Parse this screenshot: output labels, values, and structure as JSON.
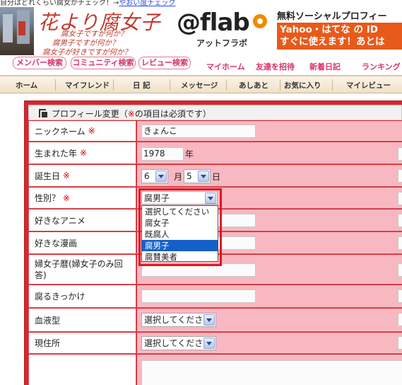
{
  "top_strip": {
    "text": "自分はどれくらい腐女かチェック！→",
    "link": "やおい度チェック"
  },
  "header": {
    "title": "花より腐女子",
    "taglines": [
      "腐女子ですが何か？",
      "腐男子ですが何か？",
      "腐女子が好きですが何か？"
    ],
    "flab_logo": "@flab",
    "flab_kana": "アットフラボ",
    "banner_title": "無料ソーシャルプロフィー",
    "banner_line1": "Yahoo・はてな の ID",
    "banner_line2": "すぐに使えます！あとは"
  },
  "search_tabs": [
    "メンバー検索",
    "コミュニティ検索",
    "レビュー検索"
  ],
  "top_nav": [
    "マイホーム",
    "友達を招待",
    "新着日記",
    "ランキング"
  ],
  "main_nav": [
    "ホーム",
    "マイフレンド",
    "日 記",
    "メッセージ",
    "あしあと",
    "お気に入り",
    "マイレビュー"
  ],
  "panel": {
    "title": "プロフィール変更",
    "note_prefix": "（",
    "note_mark": "※",
    "note_suffix": "の項目は必須です）"
  },
  "required_mark": "※",
  "fields": {
    "nickname": {
      "label": "ニックネーム",
      "value": "きょんこ"
    },
    "birth_year": {
      "label": "生まれた年",
      "value": "1978",
      "suffix": "年"
    },
    "birthday": {
      "label": "誕生日",
      "month": "6",
      "month_suffix": "月",
      "day": "5",
      "day_suffix": "日"
    },
    "gender": {
      "label": "性別？",
      "selected": "腐男子"
    },
    "anime": {
      "label": "好きなアニメ",
      "value": ""
    },
    "manga": {
      "label": "好きな漫画",
      "value": ""
    },
    "fujoshi_years": {
      "label": "婦女子暦(婦女子のみ回答)",
      "value": ""
    },
    "trigger": {
      "label": "腐るきっかけ",
      "value": ""
    },
    "blood_type": {
      "label": "血液型",
      "selected": "選択してください"
    },
    "residence": {
      "label": "現住所",
      "selected": "選択してください"
    }
  },
  "gender_options": [
    "選択してください",
    "腐女子",
    "既腐人",
    "腐男子",
    "腐賛美者"
  ],
  "colors": {
    "accent_red": "#d8262e",
    "value_pink": "#f7b8c2",
    "link_pink": "#d6336c",
    "highlight_blue": "#1560c8",
    "banner_orange": "#e85a1a"
  }
}
